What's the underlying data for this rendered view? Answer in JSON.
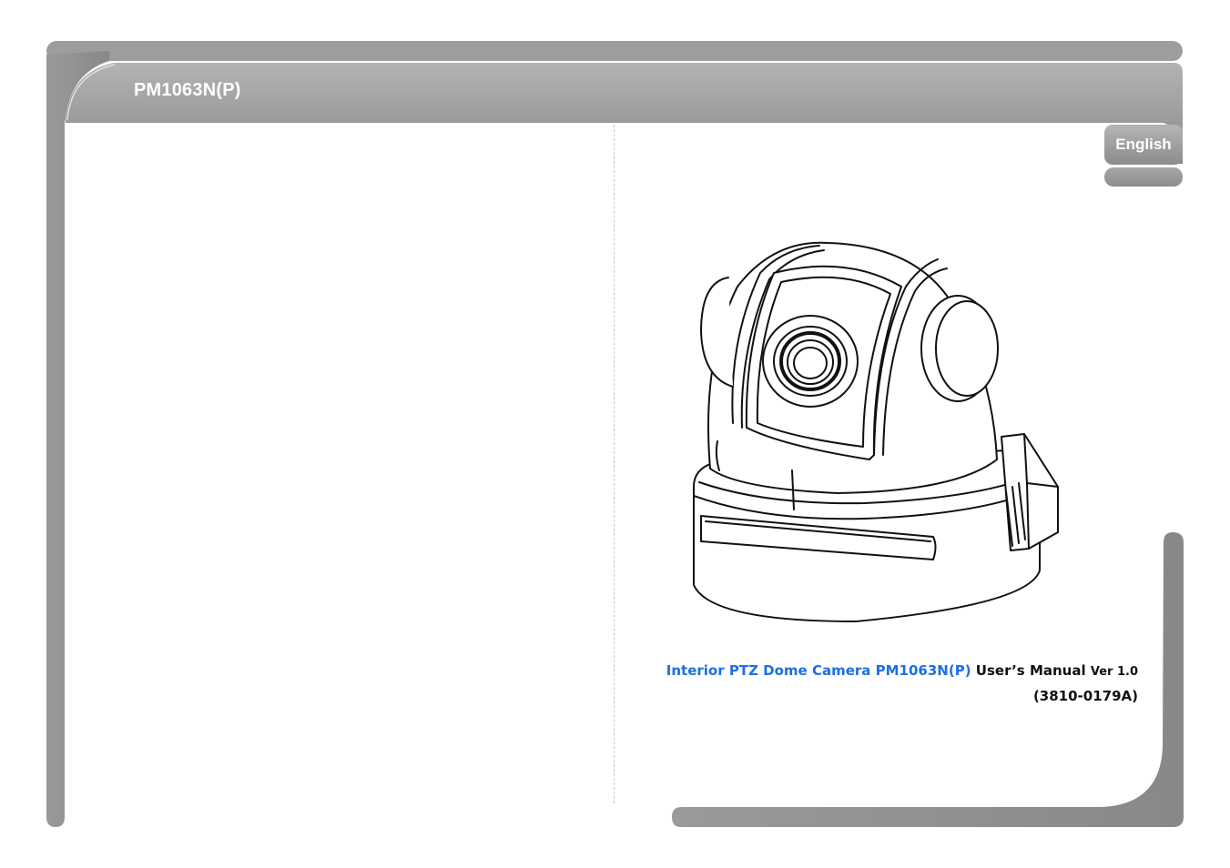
{
  "header": {
    "title": "PM1063N(P)"
  },
  "language_tab": {
    "label": "English"
  },
  "caption": {
    "product": "Interior PTZ Dome Camera PM1063N(P)",
    "doc": "User’s Manual",
    "version": "Ver 1.0",
    "code": "(3810-0179A)"
  },
  "colors": {
    "frame": "#8f8f8f",
    "accent_text": "#1e6fe0"
  },
  "icons": {
    "product_image": "ptz-dome-camera-illustration"
  }
}
